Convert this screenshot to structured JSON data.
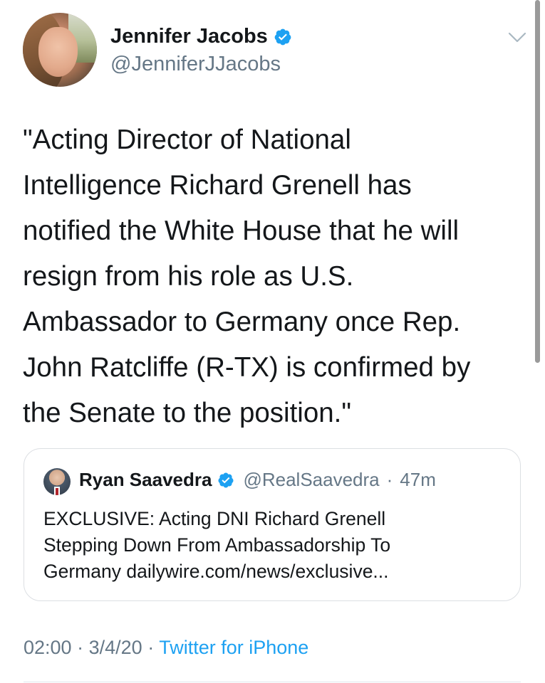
{
  "tweet": {
    "author_name": "Jennifer Jacobs",
    "author_handle": "@JenniferJJacobs",
    "text": "\"Acting Director of National\nIntelligence Richard Grenell has\nnotified the White House that he will\nresign from his role as U.S.\nAmbassador to Germany once Rep.\nJohn Ratcliffe (R-TX) is confirmed by\nthe Senate to the position.\"",
    "time": "02:00",
    "date": "3/4/20",
    "separator": "·",
    "source": "Twitter for iPhone"
  },
  "quoted": {
    "author_name": "Ryan Saavedra",
    "author_handle": "@RealSaavedra",
    "age": "47m",
    "separator": "·",
    "text": "EXCLUSIVE: Acting DNI Richard Grenell\nStepping Down From Ambassadorship To\nGermany dailywire.com/news/exclusive..."
  },
  "icons": {
    "verified": "verified-badge-icon",
    "menu": "chevron-down-icon"
  },
  "colors": {
    "verified_blue": "#1da1f2",
    "secondary_text": "#657786",
    "link_blue": "#1da1f2"
  }
}
